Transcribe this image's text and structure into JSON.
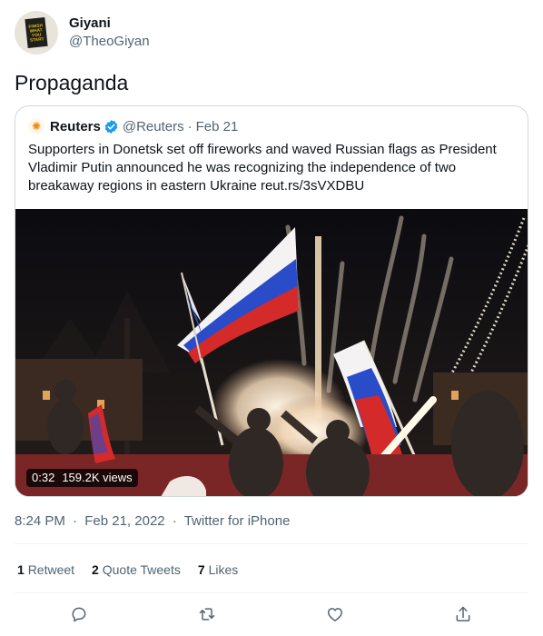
{
  "tweet": {
    "author": {
      "name": "Giyani",
      "handle": "@TheoGiyan",
      "avatar_book_text": [
        "FINISH",
        "WHAT",
        "YOU",
        "START"
      ]
    },
    "text": "Propaganda",
    "quoted": {
      "author": "Reuters",
      "verified": true,
      "handle": "@Reuters",
      "separator": "·",
      "date": "Feb 21",
      "text": "Supporters in Donetsk set off fireworks and waved Russian flags as President Vladimir Putin announced he was recognizing the independence of two breakaway regions in eastern Ukraine reut.rs/3sVXDBU",
      "video": {
        "duration": "0:32",
        "views": "159.2K views"
      }
    },
    "timestamp": {
      "time": "8:24 PM",
      "separator": "·",
      "date": "Feb 21, 2022",
      "source": "Twitter for iPhone"
    },
    "stats": [
      {
        "count": "1",
        "label": "Retweet"
      },
      {
        "count": "2",
        "label": "Quote Tweets"
      },
      {
        "count": "7",
        "label": "Likes"
      }
    ],
    "actions": [
      "reply-icon",
      "retweet-icon",
      "like-icon",
      "share-icon"
    ]
  },
  "colors": {
    "text": "#0f1419",
    "muted": "#536471",
    "border": "#cfd9de",
    "verified": "#1d9bf0"
  }
}
